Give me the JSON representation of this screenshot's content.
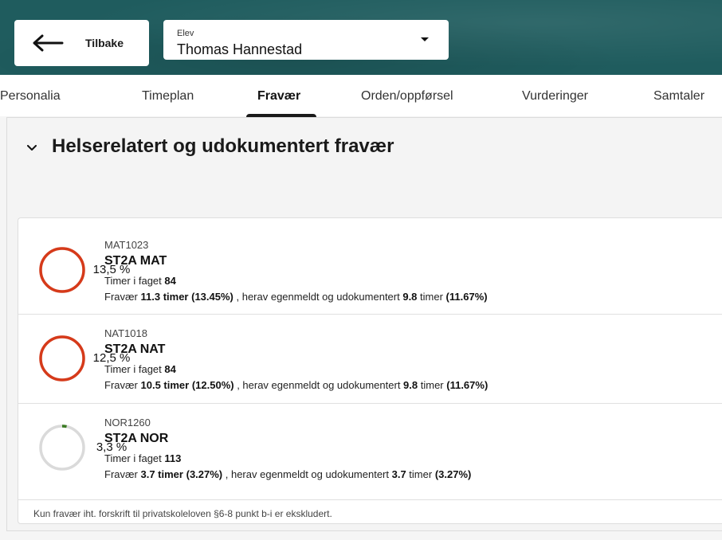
{
  "header": {
    "back_label": "Tilbake",
    "student_caption": "Elev",
    "student_name": "Thomas Hannestad"
  },
  "tabs": [
    {
      "label": "Personalia",
      "active": false
    },
    {
      "label": "Timeplan",
      "active": false
    },
    {
      "label": "Fravær",
      "active": true
    },
    {
      "label": "Orden/oppførsel",
      "active": false
    },
    {
      "label": "Vurderinger",
      "active": false
    },
    {
      "label": "Samtaler",
      "active": false
    }
  ],
  "section": {
    "title": "Helserelatert og udokumentert fravær",
    "icon": "chevron-down-icon"
  },
  "subjects": [
    {
      "code": "MAT1023",
      "name": "ST2A MAT",
      "ring_label": "13,5 %",
      "ring_fraction": 0.135,
      "ring_color": "#d63a1a",
      "hours_prefix": "Timer i faget ",
      "hours": "84",
      "absence_prefix": "Fravær ",
      "absence_hours": "11.3 timer",
      "absence_pct": "(13.45%)",
      "absence_mid": " , herav egenmeldt og udokumentert ",
      "self_reported": "9.8",
      "timer_word": " timer ",
      "self_reported_pct": "(11.67%)"
    },
    {
      "code": "NAT1018",
      "name": "ST2A NAT",
      "ring_label": "12,5 %",
      "ring_fraction": 0.125,
      "ring_color": "#d63a1a",
      "hours_prefix": "Timer i faget ",
      "hours": "84",
      "absence_prefix": "Fravær ",
      "absence_hours": "10.5 timer",
      "absence_pct": "(12.50%)",
      "absence_mid": " , herav egenmeldt og udokumentert ",
      "self_reported": "9.8",
      "timer_word": " timer ",
      "self_reported_pct": "(11.67%)"
    },
    {
      "code": "NOR1260",
      "name": "ST2A NOR",
      "ring_label": "3,3 %",
      "ring_fraction": 0.033,
      "ring_color": "#3a7a22",
      "hours_prefix": "Timer i faget ",
      "hours": "113",
      "absence_prefix": "Fravær ",
      "absence_hours": "3.7 timer",
      "absence_pct": "(3.27%)",
      "absence_mid": " , herav egenmeldt og udokumentert ",
      "self_reported": "3.7",
      "timer_word": " timer ",
      "self_reported_pct": "(3.27%)"
    }
  ],
  "footnote": "Kun fravær iht. forskrift til privatskoleloven §6-8 punkt b-i er ekskludert."
}
